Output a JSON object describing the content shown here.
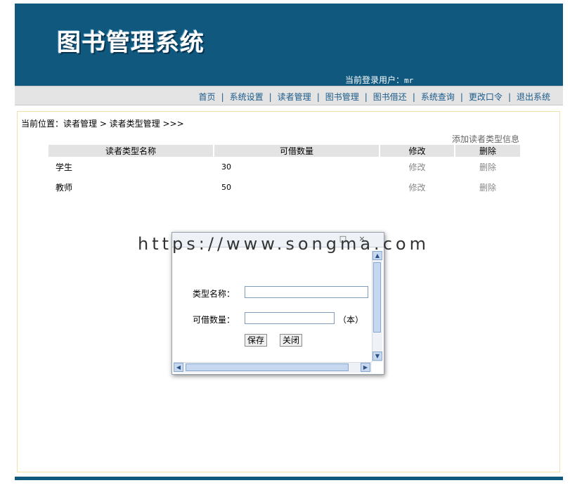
{
  "header": {
    "logo_text": "图书管理系统",
    "user_label": "当前登录用户：",
    "user_name": "mr"
  },
  "nav": {
    "items": [
      "首页",
      "系统设置",
      "读者管理",
      "图书管理",
      "图书借还",
      "系统查询",
      "更改口令",
      "退出系统"
    ],
    "separator": "|"
  },
  "breadcrumb": "当前位置：读者管理 > 读者类型管理 >>>",
  "add_link": "添加读者类型信息",
  "table": {
    "headers": [
      "读者类型名称",
      "可借数量",
      "修改",
      "删除"
    ],
    "rows": [
      {
        "name": "学生",
        "count": "30",
        "edit": "修改",
        "delete": "删除"
      },
      {
        "name": "教师",
        "count": "50",
        "edit": "修改",
        "delete": "删除"
      }
    ]
  },
  "watermark": "https://www.songma.com",
  "dialog": {
    "type_label": "类型名称：",
    "type_value": "",
    "count_label": "可借数量：",
    "count_value": "",
    "unit": "（本）",
    "save": "保存",
    "close": "关闭",
    "title_buttons": [
      "□",
      "×"
    ]
  },
  "colors": {
    "header_bg": "#11587f",
    "nav_link": "#1a5a8a",
    "table_header_bg": "#e3e3e3",
    "content_border": "#f2e2a8"
  }
}
